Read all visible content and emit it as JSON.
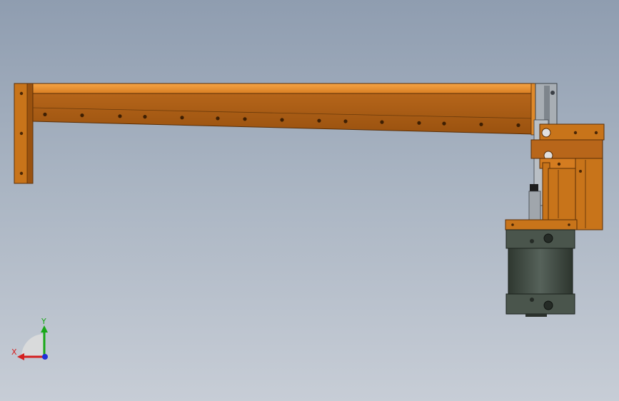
{
  "viewport": {
    "background_top": "#8f9db0",
    "background_bottom": "#c7cdd6"
  },
  "model": {
    "part_color": "#c8741a",
    "part_dark": "#8a4a0e",
    "part_light": "#f09a3a",
    "cylinder_color": "#3f4a40",
    "steel_color": "#9aa0a6"
  },
  "triad": {
    "x_label": "X",
    "y_label": "Y",
    "x_color": "#d42020",
    "y_color": "#18a818",
    "z_color": "#2030d8"
  }
}
